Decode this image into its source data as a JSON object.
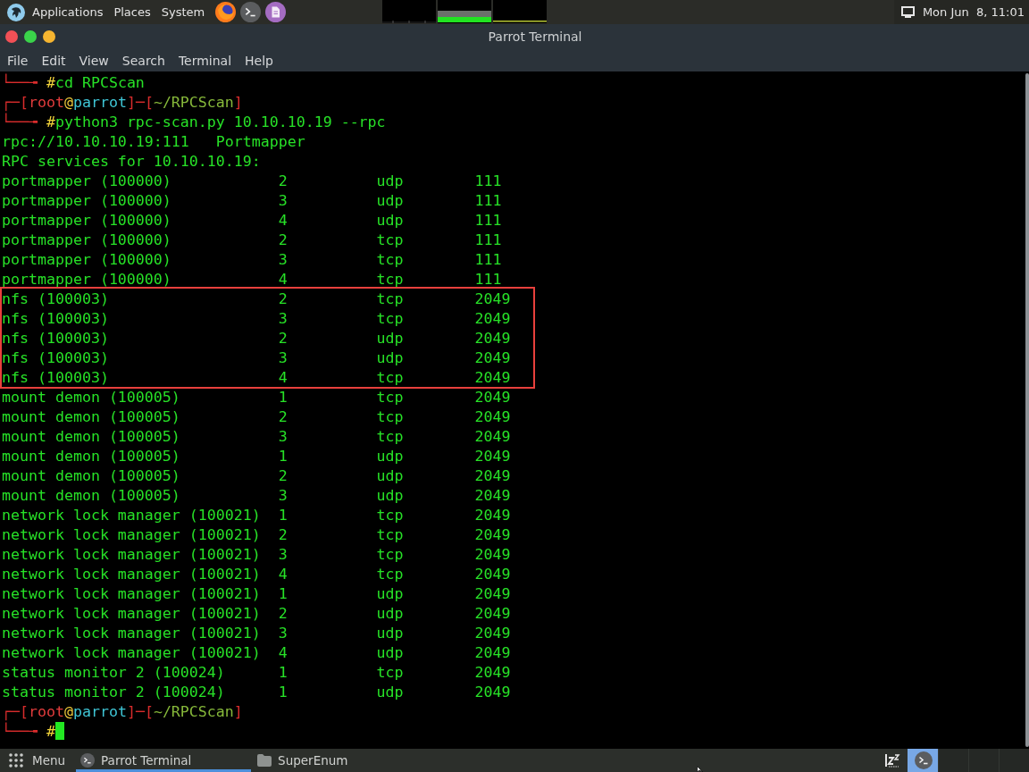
{
  "top_panel": {
    "menus": [
      "Applications",
      "Places",
      "System"
    ],
    "clock": "Mon Jun  8, 11:01"
  },
  "window": {
    "title": "Parrot Terminal",
    "menu": [
      "File",
      "Edit",
      "View",
      "Search",
      "Terminal",
      "Help"
    ]
  },
  "terminal": {
    "lines": [
      {
        "kind": "command",
        "branch": "└──╼ ",
        "symbol": "#",
        "text": "cd RPCScan",
        "cursor": false
      },
      {
        "kind": "header",
        "parts": [
          {
            "kind": "frame",
            "text": "┌─["
          },
          {
            "kind": "user",
            "text": "root"
          },
          {
            "kind": "at",
            "text": "@"
          },
          {
            "kind": "host",
            "text": "parrot"
          },
          {
            "kind": "frame",
            "text": "]─["
          },
          {
            "kind": "path",
            "text": "~/RPCScan"
          },
          {
            "kind": "frame",
            "text": "]"
          }
        ]
      },
      {
        "kind": "command",
        "branch": "└──╼ ",
        "symbol": "#",
        "text": "python3 rpc-scan.py 10.10.10.19 --rpc",
        "cursor": false
      },
      {
        "kind": "output",
        "text": "rpc://10.10.10.19:111   Portmapper"
      },
      {
        "kind": "output",
        "text": "RPC services for 10.10.10.19:"
      },
      {
        "kind": "service",
        "name": "portmapper (100000)",
        "version": "2",
        "protocol": "udp",
        "port": "111",
        "highlighted": false
      },
      {
        "kind": "service",
        "name": "portmapper (100000)",
        "version": "3",
        "protocol": "udp",
        "port": "111",
        "highlighted": false
      },
      {
        "kind": "service",
        "name": "portmapper (100000)",
        "version": "4",
        "protocol": "udp",
        "port": "111",
        "highlighted": false
      },
      {
        "kind": "service",
        "name": "portmapper (100000)",
        "version": "2",
        "protocol": "tcp",
        "port": "111",
        "highlighted": false
      },
      {
        "kind": "service",
        "name": "portmapper (100000)",
        "version": "3",
        "protocol": "tcp",
        "port": "111",
        "highlighted": false
      },
      {
        "kind": "service",
        "name": "portmapper (100000)",
        "version": "4",
        "protocol": "tcp",
        "port": "111",
        "highlighted": false
      },
      {
        "kind": "service",
        "name": "nfs (100003)",
        "version": "2",
        "protocol": "tcp",
        "port": "2049",
        "highlighted": true
      },
      {
        "kind": "service",
        "name": "nfs (100003)",
        "version": "3",
        "protocol": "tcp",
        "port": "2049",
        "highlighted": true
      },
      {
        "kind": "service",
        "name": "nfs (100003)",
        "version": "2",
        "protocol": "udp",
        "port": "2049",
        "highlighted": true
      },
      {
        "kind": "service",
        "name": "nfs (100003)",
        "version": "3",
        "protocol": "udp",
        "port": "2049",
        "highlighted": true
      },
      {
        "kind": "service",
        "name": "nfs (100003)",
        "version": "4",
        "protocol": "tcp",
        "port": "2049",
        "highlighted": true
      },
      {
        "kind": "service",
        "name": "mount demon (100005)",
        "version": "1",
        "protocol": "tcp",
        "port": "2049",
        "highlighted": false
      },
      {
        "kind": "service",
        "name": "mount demon (100005)",
        "version": "2",
        "protocol": "tcp",
        "port": "2049",
        "highlighted": false
      },
      {
        "kind": "service",
        "name": "mount demon (100005)",
        "version": "3",
        "protocol": "tcp",
        "port": "2049",
        "highlighted": false
      },
      {
        "kind": "service",
        "name": "mount demon (100005)",
        "version": "1",
        "protocol": "udp",
        "port": "2049",
        "highlighted": false
      },
      {
        "kind": "service",
        "name": "mount demon (100005)",
        "version": "2",
        "protocol": "udp",
        "port": "2049",
        "highlighted": false
      },
      {
        "kind": "service",
        "name": "mount demon (100005)",
        "version": "3",
        "protocol": "udp",
        "port": "2049",
        "highlighted": false
      },
      {
        "kind": "service",
        "name": "network lock manager (100021)",
        "version": "1",
        "protocol": "tcp",
        "port": "2049",
        "highlighted": false
      },
      {
        "kind": "service",
        "name": "network lock manager (100021)",
        "version": "2",
        "protocol": "tcp",
        "port": "2049",
        "highlighted": false
      },
      {
        "kind": "service",
        "name": "network lock manager (100021)",
        "version": "3",
        "protocol": "tcp",
        "port": "2049",
        "highlighted": false
      },
      {
        "kind": "service",
        "name": "network lock manager (100021)",
        "version": "4",
        "protocol": "tcp",
        "port": "2049",
        "highlighted": false
      },
      {
        "kind": "service",
        "name": "network lock manager (100021)",
        "version": "1",
        "protocol": "udp",
        "port": "2049",
        "highlighted": false
      },
      {
        "kind": "service",
        "name": "network lock manager (100021)",
        "version": "2",
        "protocol": "udp",
        "port": "2049",
        "highlighted": false
      },
      {
        "kind": "service",
        "name": "network lock manager (100021)",
        "version": "3",
        "protocol": "udp",
        "port": "2049",
        "highlighted": false
      },
      {
        "kind": "service",
        "name": "network lock manager (100021)",
        "version": "4",
        "protocol": "udp",
        "port": "2049",
        "highlighted": false
      },
      {
        "kind": "service",
        "name": "status monitor 2 (100024)",
        "version": "1",
        "protocol": "tcp",
        "port": "2049",
        "highlighted": false
      },
      {
        "kind": "service",
        "name": "status monitor 2 (100024)",
        "version": "1",
        "protocol": "udp",
        "port": "2049",
        "highlighted": false
      },
      {
        "kind": "header",
        "parts": [
          {
            "kind": "frame",
            "text": "┌─["
          },
          {
            "kind": "user",
            "text": "root"
          },
          {
            "kind": "at",
            "text": "@"
          },
          {
            "kind": "host",
            "text": "parrot"
          },
          {
            "kind": "frame",
            "text": "]─["
          },
          {
            "kind": "path",
            "text": "~/RPCScan"
          },
          {
            "kind": "frame",
            "text": "]"
          }
        ]
      },
      {
        "kind": "command",
        "branch": "└──╼ ",
        "symbol": "#",
        "cursor": true
      }
    ]
  },
  "taskbar": {
    "menu_label": "Menu",
    "tasks": [
      {
        "label": "Parrot Terminal",
        "kind": "terminal",
        "selected": true
      },
      {
        "label": "SuperEnum",
        "kind": "folder",
        "selected": false
      }
    ],
    "workspaces": [
      {
        "selected": true
      },
      {
        "selected": false
      },
      {
        "selected": false
      },
      {
        "selected": false
      }
    ]
  }
}
